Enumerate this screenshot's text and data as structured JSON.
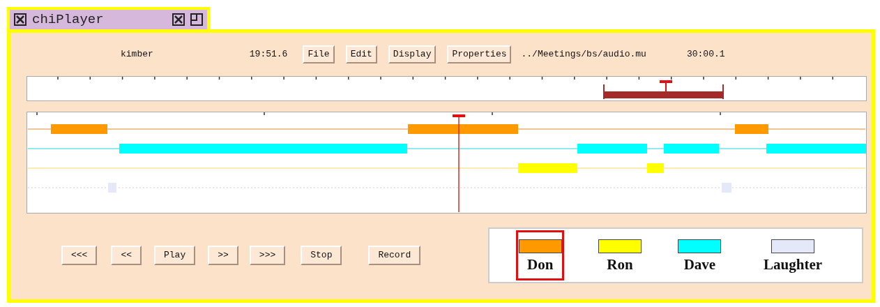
{
  "window": {
    "title": "chiPlayer"
  },
  "toolbar": {
    "user": "kimber",
    "current_time": "19:51.6",
    "menu_buttons": [
      "File",
      "Edit",
      "Display",
      "Properties"
    ],
    "file_path": "../Meetings/bs/audio.mu",
    "duration": "30:00.1"
  },
  "transport_buttons": [
    "<<<",
    "<<",
    "Play",
    ">>",
    ">>>",
    "Stop",
    "Record"
  ],
  "legend": [
    {
      "name": "Don",
      "color": "#ff9900",
      "selected": true
    },
    {
      "name": "Ron",
      "color": "#ffff00",
      "selected": false
    },
    {
      "name": "Dave",
      "color": "#00ffff",
      "selected": false
    },
    {
      "name": "Laughter",
      "color": "#e4e8f8",
      "selected": false
    }
  ]
}
